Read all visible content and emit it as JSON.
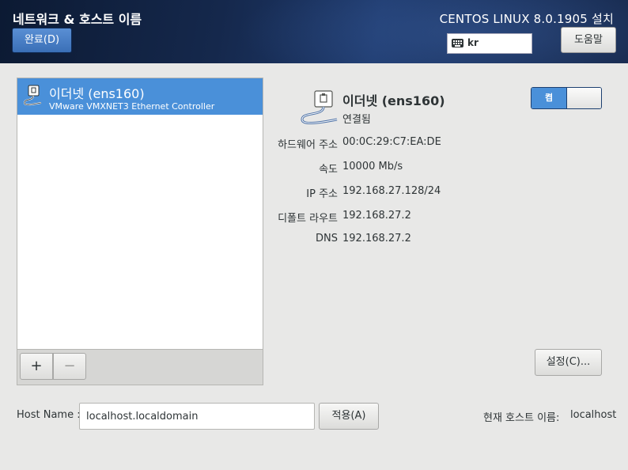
{
  "header": {
    "spoke_title": "네트워크 & 호스트 이름",
    "done_label": "완료(D)",
    "product_title": "CENTOS LINUX 8.0.1905 설치",
    "keyboard_layout": "kr",
    "help_label": "도움말"
  },
  "device_list": {
    "items": [
      {
        "name": "이더넷 (ens160)",
        "description": "VMware VMXNET3 Ethernet Controller",
        "selected": true
      }
    ],
    "add_label": "+",
    "remove_label": "−"
  },
  "device": {
    "name": "이더넷 (ens160)",
    "status": "연결됨",
    "toggle_label": "켬",
    "toggle_on": true,
    "details": [
      {
        "label": "하드웨어 주소",
        "value": "00:0C:29:C7:EA:DE"
      },
      {
        "label": "속도",
        "value": "10000 Mb/s"
      },
      {
        "label": "IP 주소",
        "value": "192.168.27.128/24"
      },
      {
        "label": "디폴트 라우트",
        "value": "192.168.27.2"
      },
      {
        "label": "DNS",
        "value": "192.168.27.2"
      }
    ],
    "configure_label": "설정(C)..."
  },
  "hostname": {
    "label": "Host Name :",
    "value": "localhost.localdomain",
    "apply_label": "적용(A)",
    "current_label": "현재 호스트 이름:",
    "current_value": "localhost"
  },
  "colors": {
    "accent": "#4a90d9",
    "header_bg": "#15284c",
    "window_bg": "#e8e8e7"
  }
}
